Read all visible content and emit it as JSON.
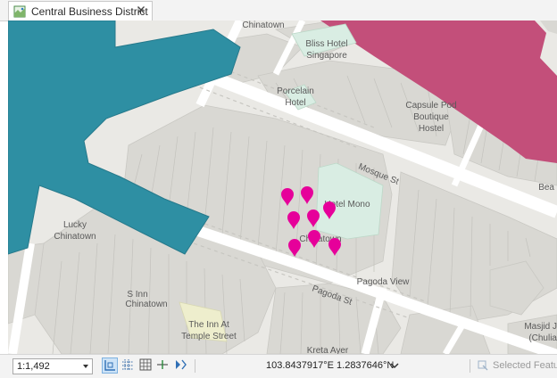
{
  "tab": {
    "title": "Central Business District",
    "icon": "map-view-icon"
  },
  "map": {
    "labels": {
      "chinatown_top": "Chinatown",
      "bliss_hotel_1": "Bliss Hotel",
      "bliss_hotel_2": "Singapore",
      "porcelain_1": "Porcelain",
      "porcelain_2": "Hotel",
      "capsule_1": "Capsule Pod",
      "capsule_2": "Boutique",
      "capsule_3": "Hostel",
      "mosque_st": "Mosque St",
      "bea": "Bea",
      "hotel_mono": "Hotel Mono",
      "lucky_1": "Lucky",
      "lucky_2": "Chinatown",
      "chinatown_centre": "Chinatown",
      "pagoda_view": "Pagoda View",
      "pagoda_st": "Pagoda St",
      "s_inn_1": "S Inn",
      "s_inn_2": "Chinatown",
      "inn_at_1": "The Inn At",
      "inn_at_2": "Temple Street",
      "kreta_ayer": "Kreta Ayer",
      "masjid_1": "Masjid J",
      "masjid_2": "(Chulia"
    },
    "pin_color": "#e6009a",
    "pin_count": 8
  },
  "statusbar": {
    "scale": "1:1,492",
    "coordinates": "103.8437917°E 1.2837646°N",
    "selected_features": "Selected Featu",
    "tools": [
      "snapping-icon",
      "grid-icon",
      "table-icon",
      "constraint-icon",
      "navigation-icon"
    ]
  },
  "colors": {
    "teal_building": "#2e8fa3",
    "magenta_building": "#c34f7a",
    "pink_building": "#e6c8cf",
    "mint_building": "#d9ede3",
    "yellow_building": "#eeeecd",
    "block": "#d9d8d3",
    "background": "#eae9e5",
    "road": "#ffffff"
  }
}
